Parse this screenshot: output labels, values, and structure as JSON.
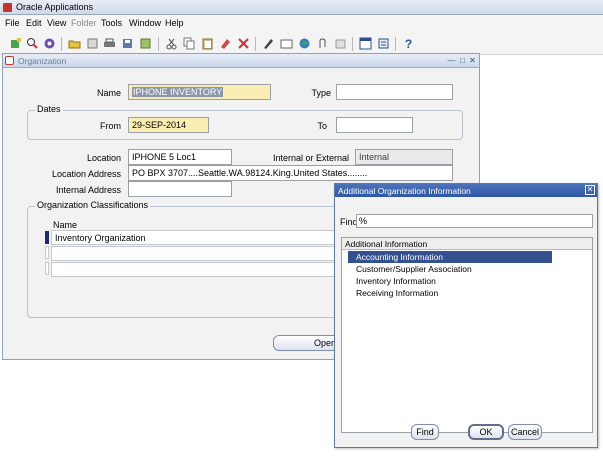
{
  "app": {
    "title": "Oracle Applications"
  },
  "menu": {
    "file": "File",
    "edit": "Edit",
    "view": "View",
    "folder": "Folder",
    "tools": "Tools",
    "window": "Window",
    "help": "Help"
  },
  "toolbar": {
    "icons": [
      "new-record-icon",
      "find-icon",
      "navigator-icon",
      "open-folder-icon",
      "close-form-icon",
      "print-icon",
      "save-icon",
      "switch-responsibility-icon",
      "cut-icon",
      "copy-icon",
      "paste-icon",
      "clear-icon",
      "delete-icon",
      "edit-field-icon",
      "zoom-icon",
      "translation-icon",
      "attachments-icon",
      "folder-tools-icon",
      "window-help-icon",
      "help-icon"
    ]
  },
  "org_window": {
    "title": "Organization",
    "name_label": "Name",
    "name_value": "IPHONE INVENTORY",
    "type_label": "Type",
    "type_value": "",
    "dates_group": "Dates",
    "from_label": "From",
    "from_value": "29-SEP-2014",
    "to_label": "To",
    "to_value": "",
    "location_label": "Location",
    "location_value": "IPHONE 5 Loc1",
    "int_ext_label": "Internal or External",
    "int_ext_value": "Internal",
    "location_address_label": "Location Address",
    "location_address_value": "PO BPX 3707....Seattle.WA.98124.King.United States........",
    "internal_address_label": "Internal Address",
    "internal_address_value": "",
    "classifications_group": "Organization Classifications",
    "classifications_name_col": "Name",
    "classifications_rows": [
      "Inventory Organization",
      "",
      ""
    ],
    "open_button": "Open"
  },
  "dialog": {
    "title": "Additional Organization Information",
    "find_label": "Find",
    "find_value": "%",
    "list_header": "Additional Information",
    "items": [
      "Accounting Information",
      "Customer/Supplier Association",
      "Inventory Information",
      "Receiving Information"
    ],
    "selected_index": 0,
    "find_button": "Find",
    "ok_button": "OK",
    "cancel_button": "Cancel"
  },
  "colors": {
    "selection": "#34508f",
    "required_field": "#fbeeb4",
    "dialog_title": "#2e57a4"
  }
}
